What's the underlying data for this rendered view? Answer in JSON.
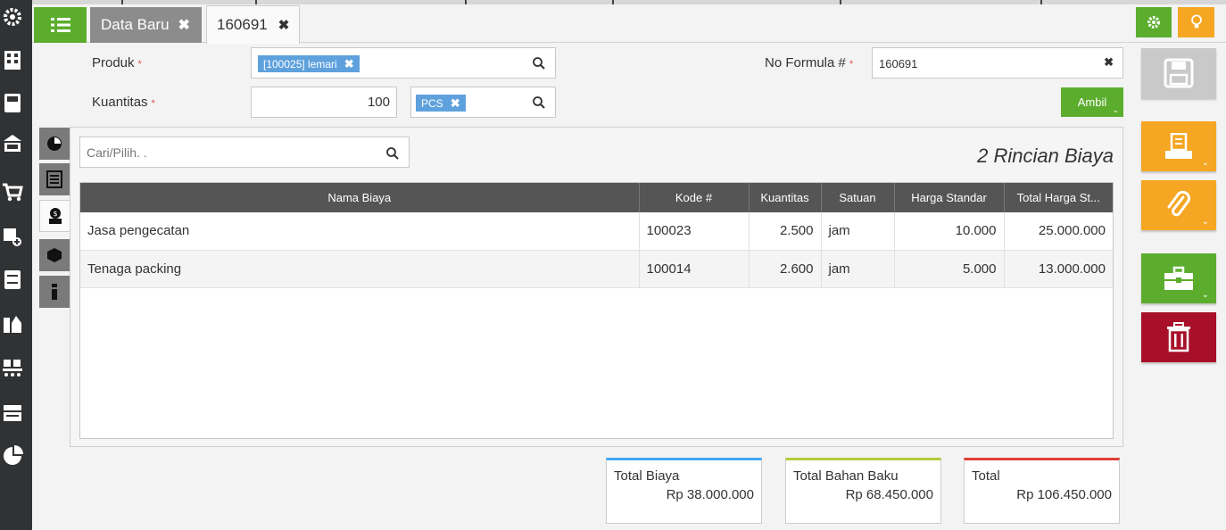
{
  "tabs": {
    "tab1_label": "Data Baru",
    "tab2_label": "160691"
  },
  "form": {
    "produk_label": "Produk",
    "produk_chip": "[100025] lemari",
    "kuantitas_label": "Kuantitas",
    "kuantitas_value": "100",
    "unit_chip": "PCS",
    "no_formula_label": "No Formula #",
    "no_formula_value": "160691",
    "required_mark": "*",
    "ambil_label": "Ambil"
  },
  "search": {
    "placeholder": "Cari/Pilih. ."
  },
  "rincian_title": "2 Rincian Biaya",
  "table": {
    "headers": [
      "Nama Biaya",
      "Kode #",
      "Kuantitas",
      "Satuan",
      "Harga Standar",
      "Total Harga St..."
    ],
    "rows": [
      [
        "Jasa pengecatan",
        "100023",
        "2.500",
        "jam",
        "10.000",
        "25.000.000"
      ],
      [
        "Tenaga packing",
        "100014",
        "2.600",
        "jam",
        "5.000",
        "13.000.000"
      ]
    ]
  },
  "totals": {
    "biaya_label": "Total Biaya",
    "biaya_value": "Rp 38.000.000",
    "bahan_label": "Total Bahan Baku",
    "bahan_value": "Rp 68.450.000",
    "total_label": "Total",
    "total_value": "Rp 106.450.000"
  },
  "colors": {
    "green": "#5cad2e",
    "orange": "#f5a623",
    "red": "#a8102a",
    "blue_accent": "#3fa9f5",
    "lime_accent": "#b5cc3a",
    "red_accent": "#e0403a"
  },
  "icons": {
    "sidebar": [
      "settings-icon",
      "building-icon",
      "calculator-icon",
      "bank-icon",
      "cart-icon",
      "truck-plus-icon",
      "cabinet-icon",
      "factory-icon",
      "conveyor-icon",
      "tax-icon",
      "pie-chart-icon"
    ],
    "side_tabs": [
      "chart-icon",
      "list-icon",
      "person-money-icon",
      "box-icon",
      "info-icon"
    ],
    "actions": [
      "save-icon",
      "print-icon",
      "attach-icon",
      "briefcase-icon",
      "trash-icon"
    ]
  }
}
